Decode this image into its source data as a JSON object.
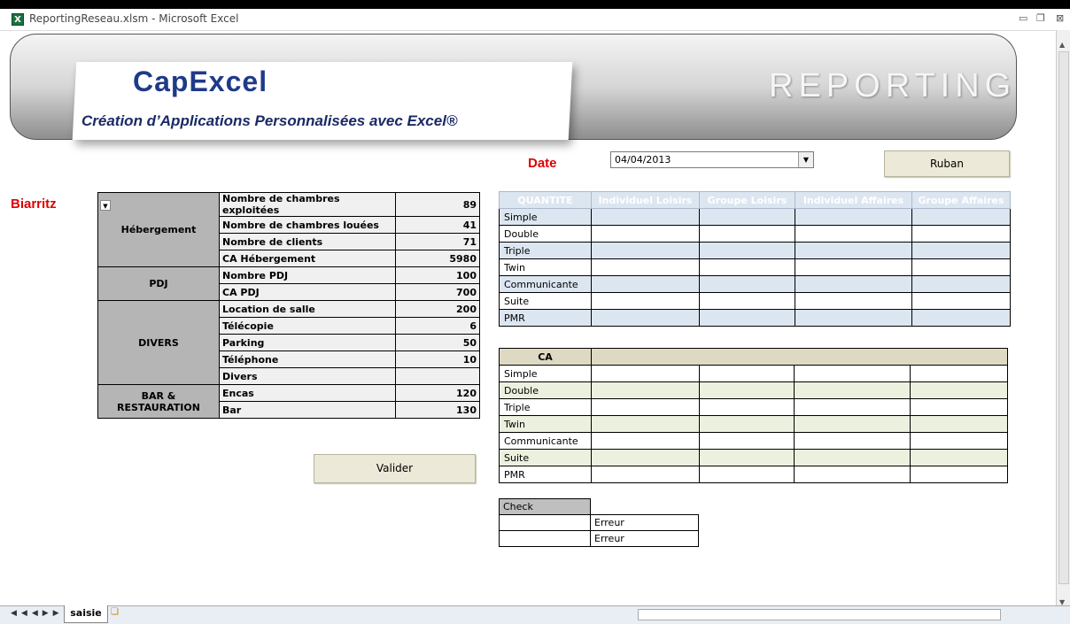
{
  "window": {
    "title": "ReportingReseau.xlsm - Microsoft Excel",
    "app_icon_text": "X"
  },
  "banner": {
    "logo": "CapExcel",
    "tagline": "Création d’Applications Personnalisées avec Excel®",
    "heading": "REPORTING"
  },
  "date": {
    "label": "Date",
    "value": "04/04/2013"
  },
  "buttons": {
    "ruban": "Ruban",
    "valider": "Valider"
  },
  "city": "Biarritz",
  "left_table": {
    "groups": [
      {
        "name": "Hébergement",
        "rows": [
          {
            "label": "Nombre de chambres exploitées",
            "value": "89"
          },
          {
            "label": "Nombre de chambres louées",
            "value": "41"
          },
          {
            "label": "Nombre de clients",
            "value": "71"
          },
          {
            "label": "CA Hébergement",
            "value": "5980"
          }
        ]
      },
      {
        "name": "PDJ",
        "rows": [
          {
            "label": "Nombre PDJ",
            "value": "100"
          },
          {
            "label": "CA PDJ",
            "value": "700"
          }
        ]
      },
      {
        "name": "DIVERS",
        "rows": [
          {
            "label": "Location de salle",
            "value": "200"
          },
          {
            "label": "Télécopie",
            "value": "6"
          },
          {
            "label": "Parking",
            "value": "50"
          },
          {
            "label": "Téléphone",
            "value": "10"
          },
          {
            "label": "Divers",
            "value": ""
          }
        ]
      },
      {
        "name": "BAR & RESTAURATION",
        "rows": [
          {
            "label": "Encas",
            "value": "120"
          },
          {
            "label": "Bar",
            "value": "130"
          }
        ]
      }
    ]
  },
  "quantite_table": {
    "headers": [
      "QUANTITE",
      "Individuel Loisirs",
      "Groupe Loisirs",
      "Individuel Affaires",
      "Groupe Affaires"
    ],
    "rows": [
      "Simple",
      "Double",
      "Triple",
      "Twin",
      "Communicante",
      "Suite",
      "PMR"
    ]
  },
  "ca_table": {
    "header": "CA",
    "rows": [
      "Simple",
      "Double",
      "Triple",
      "Twin",
      "Communicante",
      "Suite",
      "PMR"
    ]
  },
  "check_table": {
    "header": "Check",
    "rows": [
      "Erreur",
      "Erreur"
    ]
  },
  "sheet_tabs": {
    "active": "saisie"
  }
}
